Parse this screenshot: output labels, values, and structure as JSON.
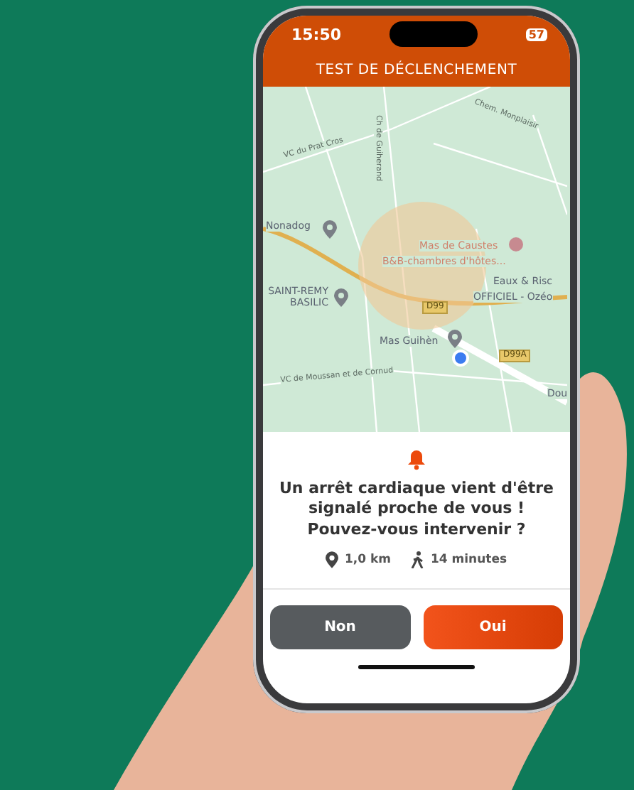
{
  "status_bar": {
    "time": "15:50",
    "battery": "57"
  },
  "header": {
    "title": "TEST DE DÉCLENCHEMENT"
  },
  "map": {
    "labels": [
      {
        "text": "Chem. Monplaisir",
        "kind": "road"
      },
      {
        "text": "VC du Prat Cros",
        "kind": "road"
      },
      {
        "text": "Ch de Guiherand",
        "kind": "road"
      },
      {
        "text": "Nonadog",
        "kind": "place"
      },
      {
        "text": "Mas de Caustes",
        "kind": "poi"
      },
      {
        "text": "B&B-chambres d'hôtes...",
        "kind": "poi"
      },
      {
        "text": "SAINT-REMY BASILIC",
        "kind": "place"
      },
      {
        "text": "Eaux & Risc",
        "kind": "place"
      },
      {
        "text": "OFFICIEL - Ozéo",
        "kind": "place"
      },
      {
        "text": "D99",
        "kind": "shield"
      },
      {
        "text": "D99A",
        "kind": "shield"
      },
      {
        "text": "Mas Guihèn",
        "kind": "place"
      },
      {
        "text": "VC de Moussan et de Cornud",
        "kind": "road"
      },
      {
        "text": "Dou",
        "kind": "place"
      }
    ]
  },
  "alert": {
    "message": "Un arrêt cardiaque vient d'être signalé proche de vous ! Pouvez-vous intervenir ?",
    "distance": "1,0 km",
    "duration": "14 minutes"
  },
  "buttons": [
    {
      "label": "Non",
      "kind": "secondary"
    },
    {
      "label": "Oui",
      "kind": "primary"
    }
  ]
}
